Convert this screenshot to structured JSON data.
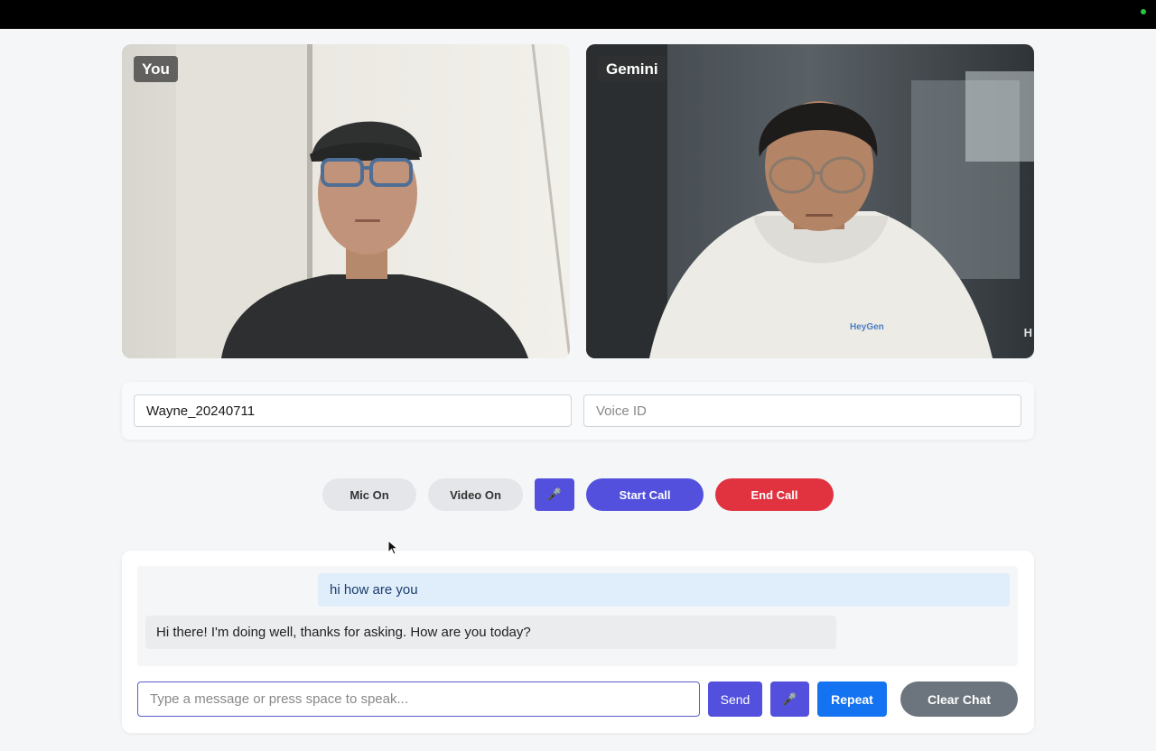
{
  "videos": {
    "local_label": "You",
    "remote_label": "Gemini",
    "remote_edge_text": "H",
    "hoodie_logo": "HeyGen"
  },
  "settings": {
    "avatar_value": "Wayne_20240711",
    "voice_placeholder": "Voice ID"
  },
  "controls": {
    "mic_label": "Mic On",
    "video_label": "Video On",
    "mic_icon": "🎤",
    "start_label": "Start Call",
    "end_label": "End Call"
  },
  "chat": {
    "messages": [
      {
        "role": "user",
        "text": "hi how are you"
      },
      {
        "role": "assistant",
        "text": "Hi there! I'm doing well, thanks for asking. How are you today?"
      }
    ],
    "input_placeholder": "Type a message or press space to speak...",
    "send_label": "Send",
    "mic_icon": "🎤",
    "repeat_label": "Repeat",
    "clear_label": "Clear Chat"
  },
  "colors": {
    "accent": "#5250dc",
    "danger": "#e0323f",
    "primary": "#1473f0",
    "secondary": "#6c757d"
  }
}
